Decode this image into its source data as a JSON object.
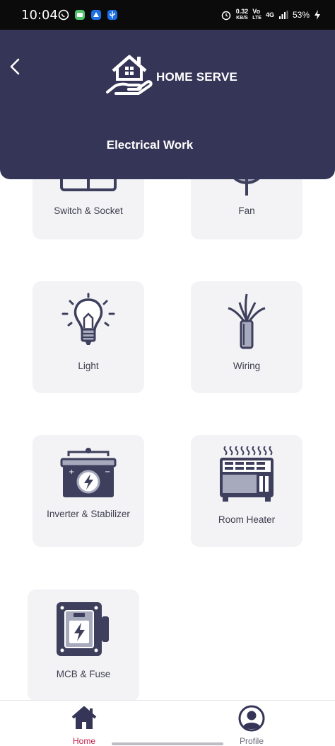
{
  "status_bar": {
    "time": "10:04",
    "net_speed_value": "0.32",
    "net_speed_unit": "KB/S",
    "volte_top": "Vo",
    "volte_bottom": "LTE",
    "network_type": "4G",
    "battery": "53%"
  },
  "header": {
    "brand": "HOME SERVE",
    "title": "Electrical Work"
  },
  "services": [
    {
      "label": "Switch & Socket"
    },
    {
      "label": "Fan"
    },
    {
      "label": "Light"
    },
    {
      "label": "Wiring"
    },
    {
      "label": "Inverter & Stabilizer"
    },
    {
      "label": "Room Heater"
    },
    {
      "label": "MCB & Fuse"
    }
  ],
  "bottom_nav": {
    "home_label": "Home",
    "profile_label": "Profile"
  },
  "colors": {
    "primary": "#353657",
    "active_nav": "#c41e4a",
    "card_bg": "#f3f3f6",
    "icon": "#3d3f5c"
  }
}
